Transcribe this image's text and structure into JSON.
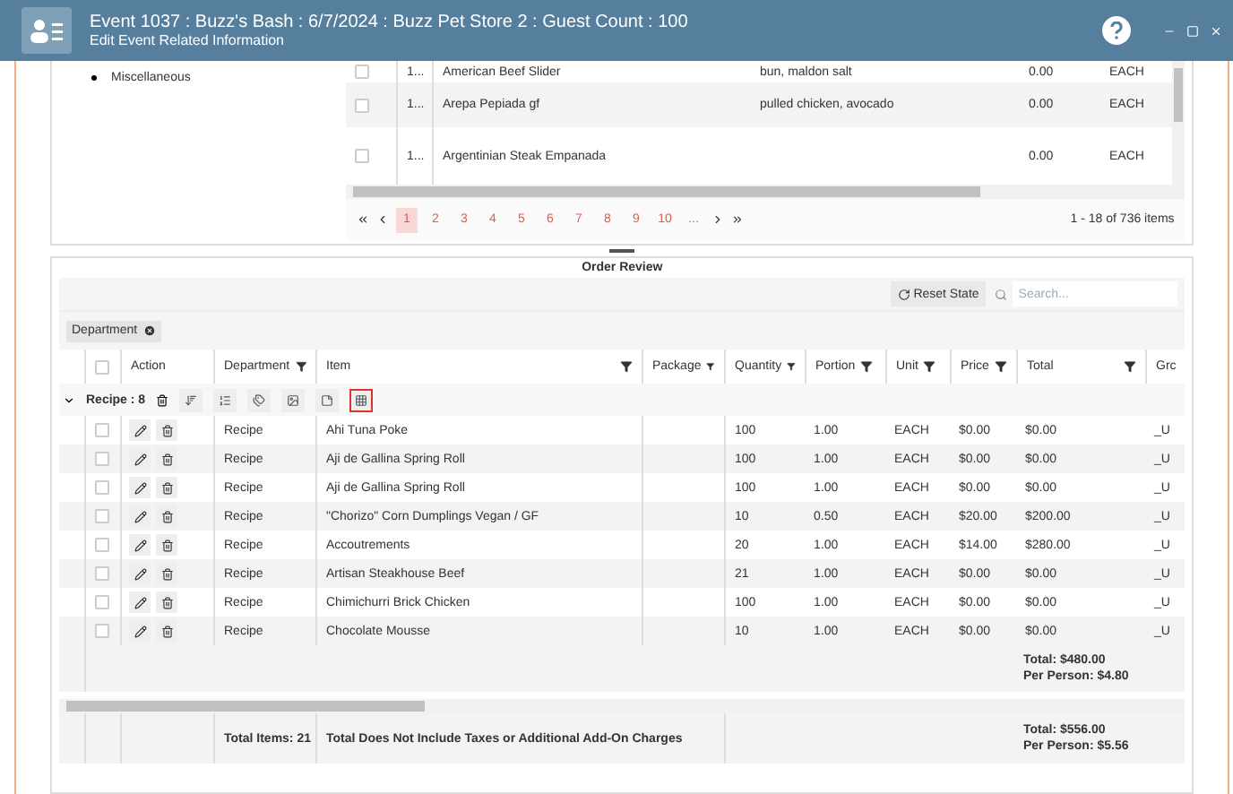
{
  "header": {
    "title": "Event 1037 : Buzz's Bash : 6/7/2024 : Buzz Pet Store 2 : Guest Count : 100",
    "subtitle": "Edit Event Related Information"
  },
  "tree": {
    "items": [
      {
        "label": "Miscellaneous"
      }
    ]
  },
  "item_grid": {
    "rows": [
      {
        "checked": false,
        "column_2": "1...",
        "column_3": "American Beef Slider",
        "column_4": "bun, maldon salt",
        "column_5": "0.00",
        "column_6": "EACH"
      },
      {
        "checked": false,
        "column_2": "1...",
        "column_3": "Arepa Pepiada gf",
        "column_4": "pulled chicken, avocado",
        "column_5": "0.00",
        "column_6": "EACH"
      },
      {
        "checked": false,
        "column_2": "1...",
        "column_3": "Argentinian Steak Empanada",
        "column_4": "",
        "column_5": "0.00",
        "column_6": "EACH"
      }
    ],
    "pager": {
      "pages": [
        {
          "label": "1",
          "selected": true
        },
        {
          "label": "2",
          "selected": false
        },
        {
          "label": "3",
          "selected": false
        },
        {
          "label": "4",
          "selected": false
        },
        {
          "label": "5",
          "selected": false
        },
        {
          "label": "6",
          "selected": false
        },
        {
          "label": "7",
          "selected": false
        },
        {
          "label": "8",
          "selected": false
        },
        {
          "label": "9",
          "selected": false
        },
        {
          "label": "10",
          "selected": false
        },
        {
          "label": "...",
          "selected": false
        }
      ],
      "info": "1 - 18 of 736 items"
    }
  },
  "order_review": {
    "title": "Order Review",
    "reset_button": "Reset State",
    "search": {
      "placeholder": "Search..."
    },
    "select_all": {
      "checked": false
    },
    "group_chips": [
      {
        "label": "Department"
      }
    ],
    "columns": [
      {
        "label": "Action",
        "filter": false
      },
      {
        "label": "Department",
        "filter": true
      },
      {
        "label": "Item",
        "filter": true
      },
      {
        "label": "Package",
        "filter": true
      },
      {
        "label": "Quantity",
        "filter": true
      },
      {
        "label": "Portion",
        "filter": true
      },
      {
        "label": "Unit",
        "filter": true
      },
      {
        "label": "Price",
        "filter": true
      },
      {
        "label": "Total",
        "filter": true
      },
      {
        "label": "Grc",
        "filter": false
      }
    ],
    "groups": [
      {
        "label": "Recipe : 8",
        "expanded": true,
        "tools": [
          {
            "highlighted": false
          },
          {
            "highlighted": false
          },
          {
            "highlighted": false
          },
          {
            "highlighted": false
          },
          {
            "highlighted": false
          },
          {
            "highlighted": true
          }
        ],
        "rows": [
          {
            "checked": false,
            "department": "Recipe",
            "item": "Ahi Tuna Poke",
            "package": "",
            "quantity": "100",
            "portion": "1.00",
            "unit": "EACH",
            "price": "$0.00",
            "total": "$0.00",
            "column_10": "_U"
          },
          {
            "checked": false,
            "department": "Recipe",
            "item": "Aji de Gallina Spring Roll",
            "package": "",
            "quantity": "100",
            "portion": "1.00",
            "unit": "EACH",
            "price": "$0.00",
            "total": "$0.00",
            "column_10": "_U"
          },
          {
            "checked": false,
            "department": "Recipe",
            "item": "Aji de Gallina Spring Roll",
            "package": "",
            "quantity": "100",
            "portion": "1.00",
            "unit": "EACH",
            "price": "$0.00",
            "total": "$0.00",
            "column_10": "_U"
          },
          {
            "checked": false,
            "department": "Recipe",
            "item": "\"Chorizo\" Corn Dumplings Vegan / GF",
            "package": "",
            "quantity": "10",
            "portion": "0.50",
            "unit": "EACH",
            "price": "$20.00",
            "total": "$200.00",
            "column_10": "_U"
          },
          {
            "checked": false,
            "department": "Recipe",
            "item": "Accoutrements",
            "package": "",
            "quantity": "20",
            "portion": "1.00",
            "unit": "EACH",
            "price": "$14.00",
            "total": "$280.00",
            "column_10": "_U"
          },
          {
            "checked": false,
            "department": "Recipe",
            "item": "Artisan Steakhouse Beef",
            "package": "",
            "quantity": "21",
            "portion": "1.00",
            "unit": "EACH",
            "price": "$0.00",
            "total": "$0.00",
            "column_10": "_U"
          },
          {
            "checked": false,
            "department": "Recipe",
            "item": "Chimichurri Brick Chicken",
            "package": "",
            "quantity": "100",
            "portion": "1.00",
            "unit": "EACH",
            "price": "$0.00",
            "total": "$0.00",
            "column_10": "_U"
          },
          {
            "checked": false,
            "department": "Recipe",
            "item": "Chocolate Mousse",
            "package": "",
            "quantity": "10",
            "portion": "1.00",
            "unit": "EACH",
            "price": "$0.00",
            "total": "$0.00",
            "column_10": "_U"
          }
        ],
        "footer": {
          "total": "Total: $480.00",
          "per_person": "Per Person: $4.80"
        }
      }
    ],
    "footer": {
      "total_items": "Total Items: 21",
      "note": "Total Does Not Include Taxes or Additional Add-On Charges",
      "total": "Total: $556.00",
      "per_person": "Per Person: $5.56"
    }
  }
}
